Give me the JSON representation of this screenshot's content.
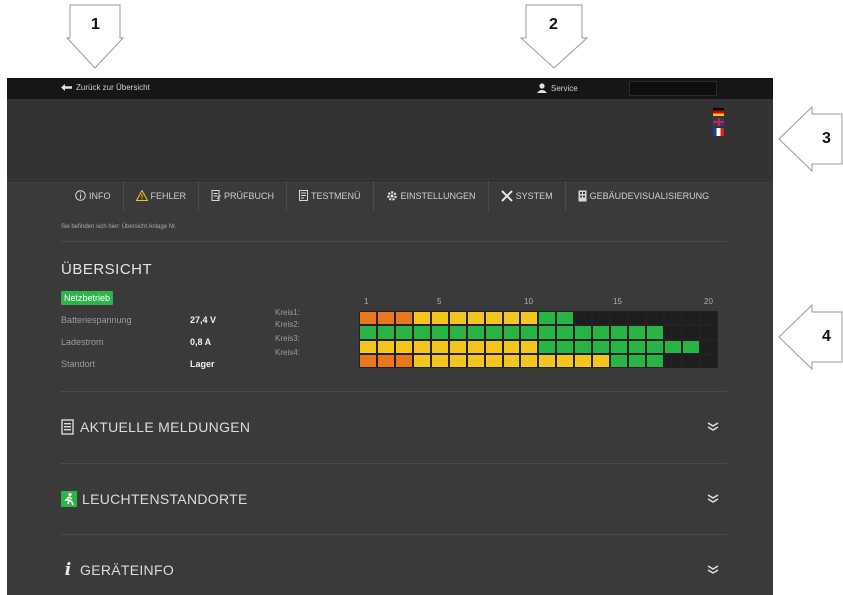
{
  "callouts": [
    "1",
    "2",
    "3",
    "4"
  ],
  "topbar": {
    "back_label": "Zurück zur Übersicht",
    "service_label": "Service"
  },
  "languages": [
    "de",
    "en",
    "fr"
  ],
  "nav": {
    "tabs": [
      {
        "label": "INFO",
        "icon": "info-icon"
      },
      {
        "label": "FEHLER",
        "icon": "warning-icon"
      },
      {
        "label": "PRÜFBUCH",
        "icon": "logbook-icon"
      },
      {
        "label": "TESTMENÜ",
        "icon": "test-menu-icon"
      },
      {
        "label": "EINSTELLUNGEN",
        "icon": "gear-icon"
      },
      {
        "label": "SYSTEM",
        "icon": "tools-icon"
      },
      {
        "label": "GEBÄUDEVISUALISIERUNG",
        "icon": "building-icon"
      }
    ]
  },
  "breadcrumb": "Sie befinden sich hier: Übersicht Anlage Nr.",
  "overview": {
    "title": "ÜBERSICHT",
    "status_badge": "Netzbetrieb",
    "rows": [
      {
        "label": "Batteriespannung",
        "value": "27,4 V"
      },
      {
        "label": "Ladestrom",
        "value": "0,8 A"
      },
      {
        "label": "Standort",
        "value": "Lager"
      }
    ]
  },
  "circuits": {
    "scale": [
      "1",
      "5",
      "10",
      "15",
      "20"
    ],
    "labels": [
      "Kreis1:",
      "Kreis2:",
      "Kreis3:",
      "Kreis4:"
    ],
    "colors": {
      "fault": "#e8781a",
      "warning": "#f4c51c",
      "ok": "#29b446",
      "empty": "#1e1e1e"
    },
    "rows": [
      [
        "o",
        "o",
        "o",
        "y",
        "y",
        "y",
        "y",
        "y",
        "y",
        "y",
        "g",
        "g",
        "d",
        "d",
        "d",
        "d",
        "d",
        "d",
        "d",
        "d"
      ],
      [
        "g",
        "g",
        "g",
        "g",
        "g",
        "g",
        "g",
        "g",
        "g",
        "g",
        "g",
        "g",
        "g",
        "g",
        "g",
        "g",
        "g",
        "d",
        "d",
        "d"
      ],
      [
        "y",
        "y",
        "y",
        "y",
        "y",
        "y",
        "y",
        "y",
        "y",
        "y",
        "g",
        "g",
        "g",
        "g",
        "g",
        "g",
        "g",
        "g",
        "g",
        "d"
      ],
      [
        "o",
        "o",
        "o",
        "y",
        "y",
        "y",
        "y",
        "y",
        "y",
        "y",
        "y",
        "y",
        "y",
        "y",
        "g",
        "g",
        "g",
        "d",
        "d",
        "d"
      ]
    ]
  },
  "sections": [
    {
      "title": "AKTUELLE MELDUNGEN",
      "icon": "messages-icon"
    },
    {
      "title": "LEUCHTENSTANDORTE",
      "icon": "emergency-exit-icon"
    },
    {
      "title": "GERÄTEINFO",
      "icon": "info-italic-icon"
    }
  ]
}
